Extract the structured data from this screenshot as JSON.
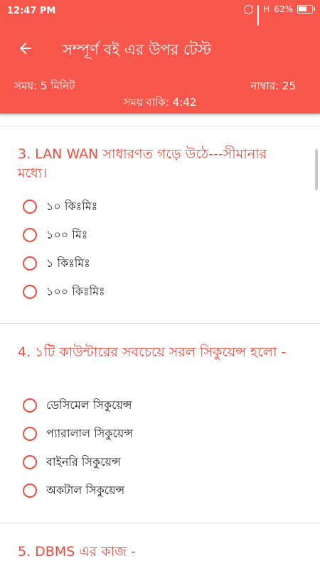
{
  "status_bar": {
    "time": "12:47 PM",
    "network": "H",
    "battery_text": "62%",
    "battery_level": 0.62
  },
  "header": {
    "title": "সম্পূর্ণ বই এর উপর টেস্ট",
    "time_label": "সময়: 5 মিনিট",
    "marks_label": "নাম্বার: 25",
    "remaining_label": "সময় বাকি: 4:42",
    "background_color": "#f7574b"
  },
  "questions": [
    {
      "number": "3.",
      "text": "3. LAN WAN সাধারণত গড়ে উঠে---সীমানার মধ্যে।",
      "options": [
        "১০ কিঃমিঃ",
        "১০০ মিঃ",
        "১ কিঃমিঃ",
        "১০০ কিঃমিঃ"
      ]
    },
    {
      "number": "4.",
      "text": "4. ১টি কাউন্টারের সবচেয়ে সরল সিকুয়েন্স হলো -",
      "options": [
        "ডেসিমেল সিকুয়েন্স",
        "প্যারালাল সিকুয়েন্স",
        "বাইনরি সিকুয়েন্স",
        "অকটাল সিকুয়েন্স"
      ]
    },
    {
      "number": "5.",
      "text": "5. DBMS এর কাজ -",
      "options": []
    }
  ],
  "accent_color": "#f24c3f"
}
